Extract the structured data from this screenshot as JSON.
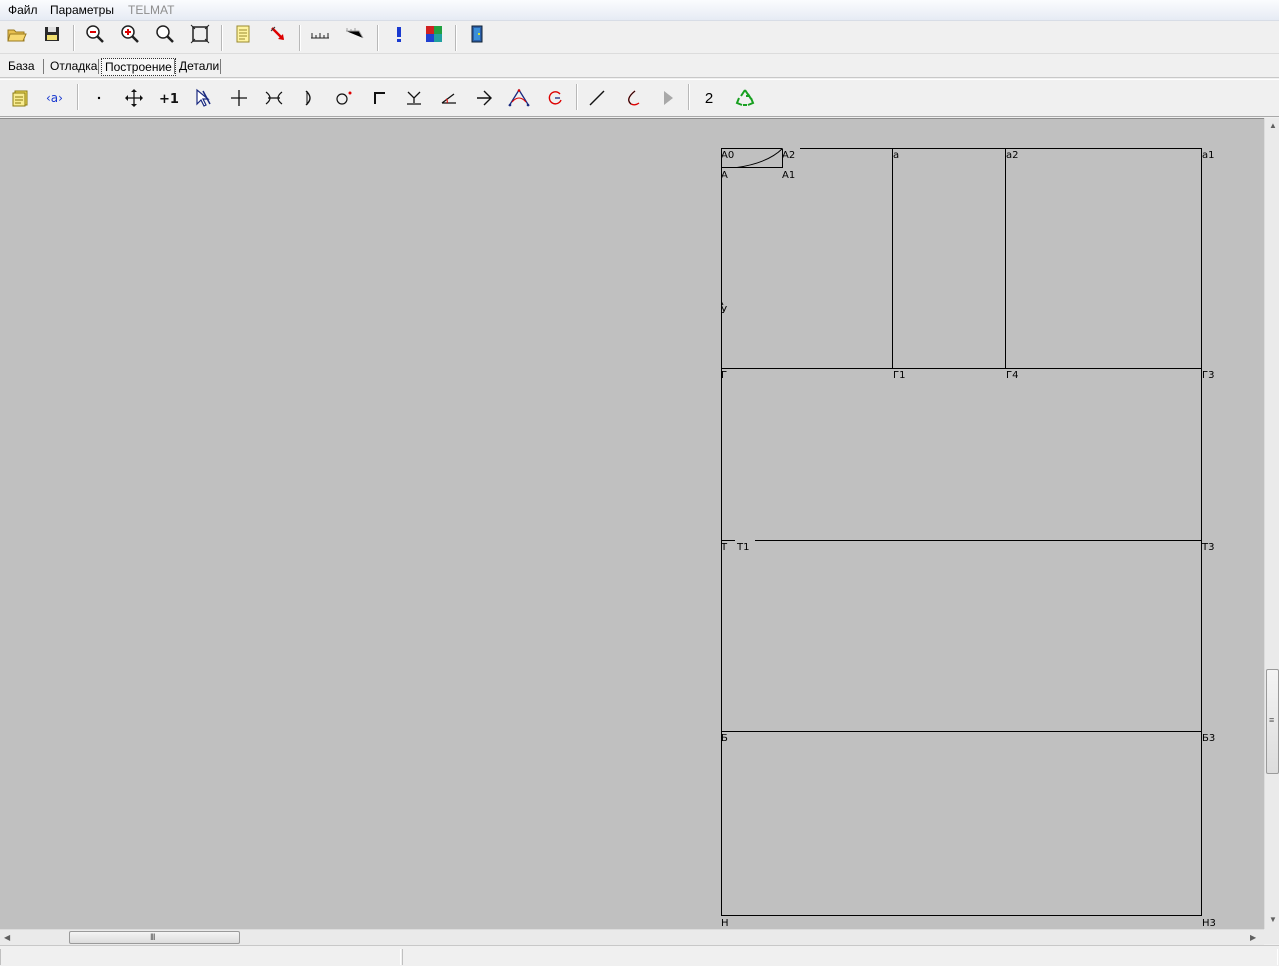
{
  "menu": {
    "file": "Файл",
    "params": "Параметры",
    "telmat": "TELMAT"
  },
  "toolbar1": {
    "icons": [
      "open-folder-icon",
      "save-disk-icon",
      "zoom-out-icon",
      "zoom-in-icon",
      "zoom-magnifier-icon",
      "zoom-fit-icon",
      "document-icon",
      "red-arrow-icon",
      "ruler-icon",
      "ruler-gray-icon",
      "exclamation-icon",
      "color-palette-icon",
      "exit-door-icon"
    ]
  },
  "tabs": {
    "base": "База",
    "debug": "Отладка",
    "build": "Построение",
    "details": "Детали",
    "active": "Построение"
  },
  "toolbar2": {
    "number_label": "2",
    "icons": [
      "notes-icon",
      "variable-a-icon",
      "point-icon",
      "move-cross-icon",
      "plus-one-icon",
      "select-cursor-icon",
      "cross-icon",
      "intersection-icon",
      "arc-point-icon",
      "circle-point-icon",
      "corner-icon",
      "bisector-icon",
      "angle-icon",
      "arrow-right-icon",
      "triangle-curve-icon",
      "circle-arrow-icon",
      "line-icon",
      "curve-icon",
      "play-icon",
      "recycle-icon"
    ]
  },
  "pattern_labels": {
    "A0": "А0",
    "A2": "А2",
    "A": "А",
    "A1": "А1",
    "a": "а",
    "a2": "а2",
    "a1": "а1",
    "U": "У",
    "G": "Г",
    "G1": "Г1",
    "G4": "Г4",
    "G3": "Г3",
    "T": "Т",
    "T1": "Т1",
    "T3": "Т3",
    "B": "Б",
    "B3": "Б3",
    "H": "Н",
    "H3": "Н3"
  },
  "colors": {
    "canvas": "#c0c0c0",
    "lines": "#000000",
    "toolbar": "#f0f0f0"
  },
  "status": {
    "cell1": "",
    "cell2": ""
  }
}
